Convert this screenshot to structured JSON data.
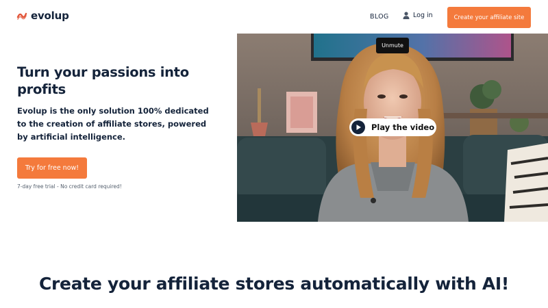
{
  "header": {
    "logo_text": "evolup",
    "nav_blog": "BLOG",
    "nav_login": "Log in",
    "cta": "Create your affiliate site"
  },
  "hero": {
    "title": "Turn your passions into profits",
    "description": "Evolup is the only solution 100% dedicated to the creation of affiliate stores, powered by artificial intelligence.",
    "cta": "Try for free now!",
    "note": "7-day free trial - No credit card required!"
  },
  "video": {
    "unmute_label": "Unmute",
    "play_label": "Play the video"
  },
  "section": {
    "title": "Create your affiliate stores automatically with AI!"
  },
  "colors": {
    "accent": "#f47a3c",
    "text": "#14233a",
    "logo_red": "#e2563a"
  },
  "icons": {
    "logo": "evolup-logo-icon",
    "login": "user-icon",
    "play": "play-icon"
  }
}
